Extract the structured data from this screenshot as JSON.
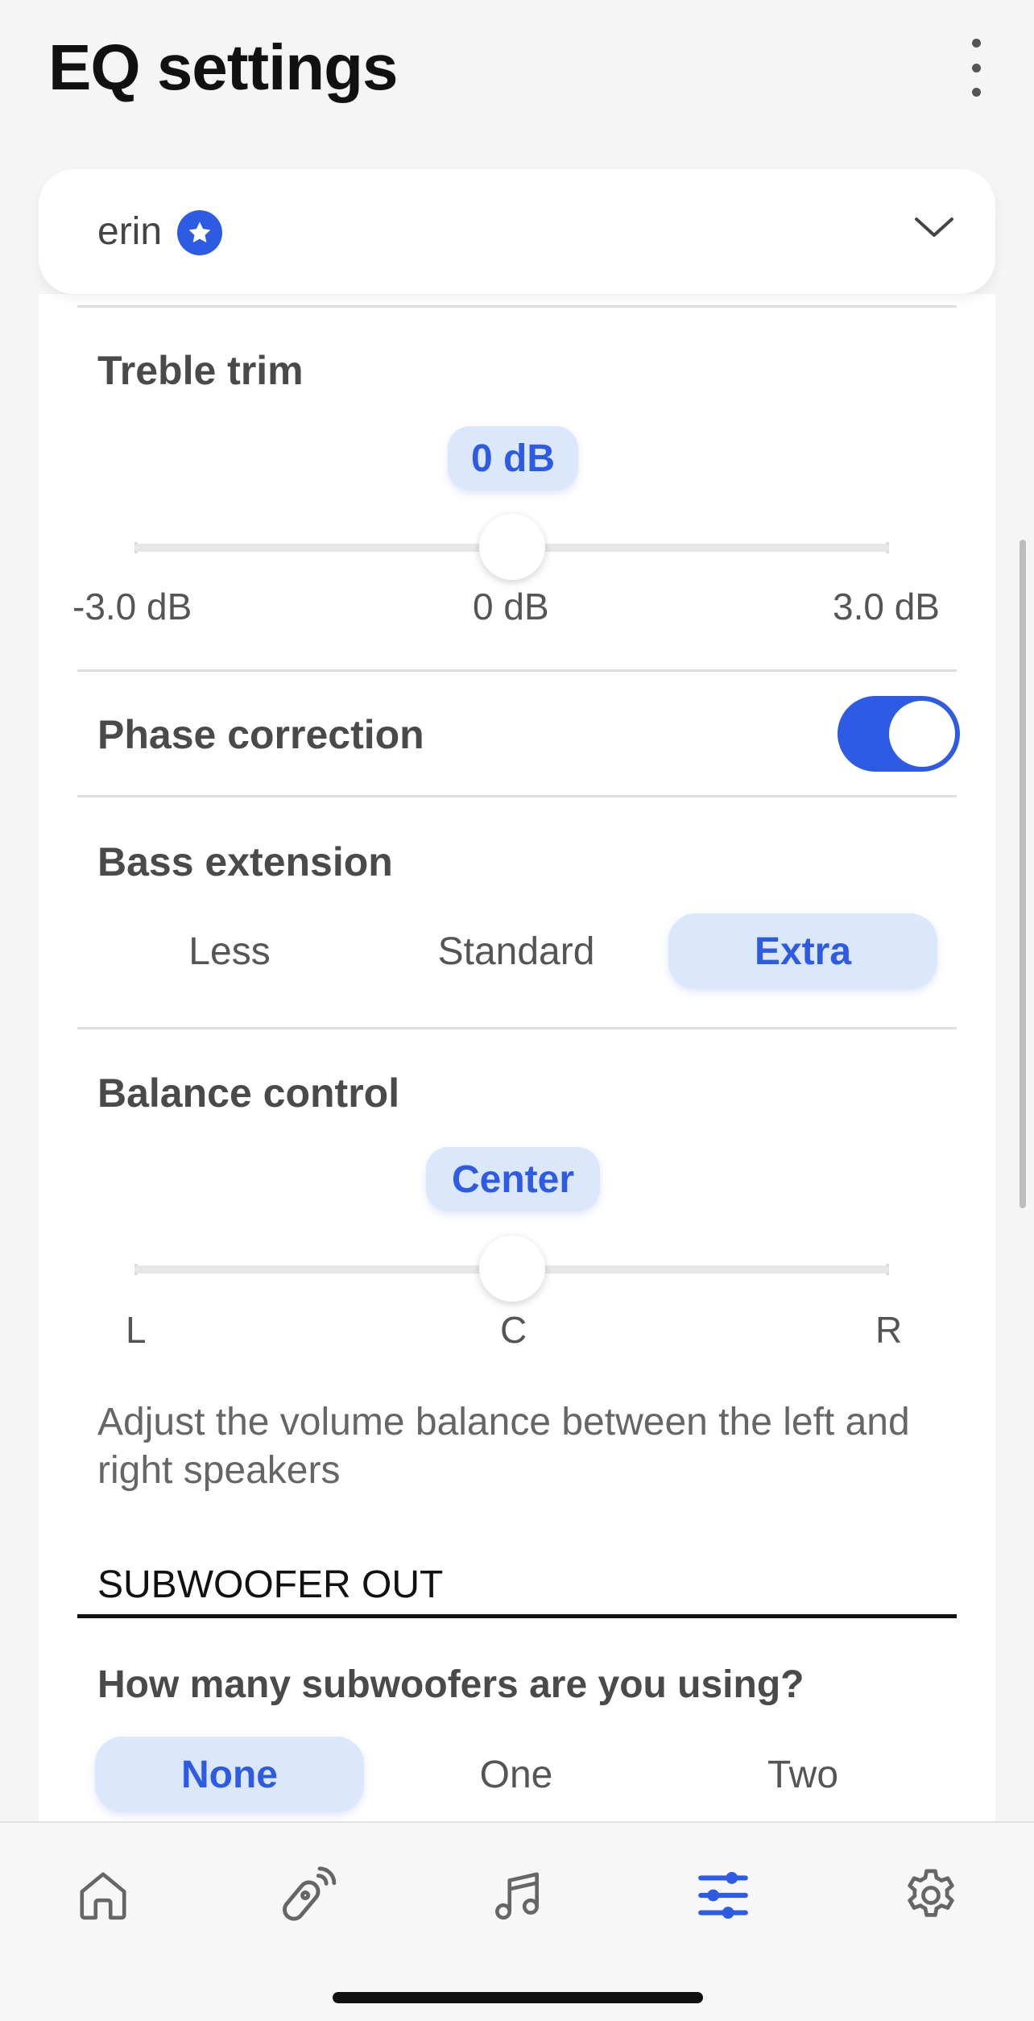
{
  "header": {
    "title": "EQ settings",
    "menu_icon": "kebab-menu-icon"
  },
  "profile": {
    "name": "erin",
    "badge_icon": "star-badge-icon",
    "expand_icon": "chevron-down-icon"
  },
  "treble": {
    "label": "Treble trim",
    "value": "0 dB",
    "level": 0.5,
    "min_label": "-3.0 dB",
    "mid_label": "0 dB",
    "max_label": "3.0 dB"
  },
  "phase": {
    "label": "Phase correction",
    "enabled": true
  },
  "bass": {
    "label": "Bass extension",
    "options": [
      "Less",
      "Standard",
      "Extra"
    ],
    "selected": "Extra"
  },
  "balance": {
    "label": "Balance control",
    "value": "Center",
    "level": 0.5,
    "left_label": "L",
    "center_label": "C",
    "right_label": "R",
    "description": "Adjust the volume balance between the left and right speakers"
  },
  "subwoofer": {
    "heading": "SUBWOOFER OUT",
    "question": "How many subwoofers are you using?",
    "options": [
      "None",
      "One",
      "Two"
    ],
    "selected": "None"
  },
  "tabs": [
    {
      "icon": "home-icon"
    },
    {
      "icon": "remote-icon"
    },
    {
      "icon": "music-note-icon"
    },
    {
      "icon": "equalizer-icon",
      "active": true
    },
    {
      "icon": "settings-gear-icon"
    }
  ],
  "colors": {
    "accent": "#2d5be3",
    "accent_soft": "#dbe7fb",
    "background": "#f5f5f6"
  }
}
